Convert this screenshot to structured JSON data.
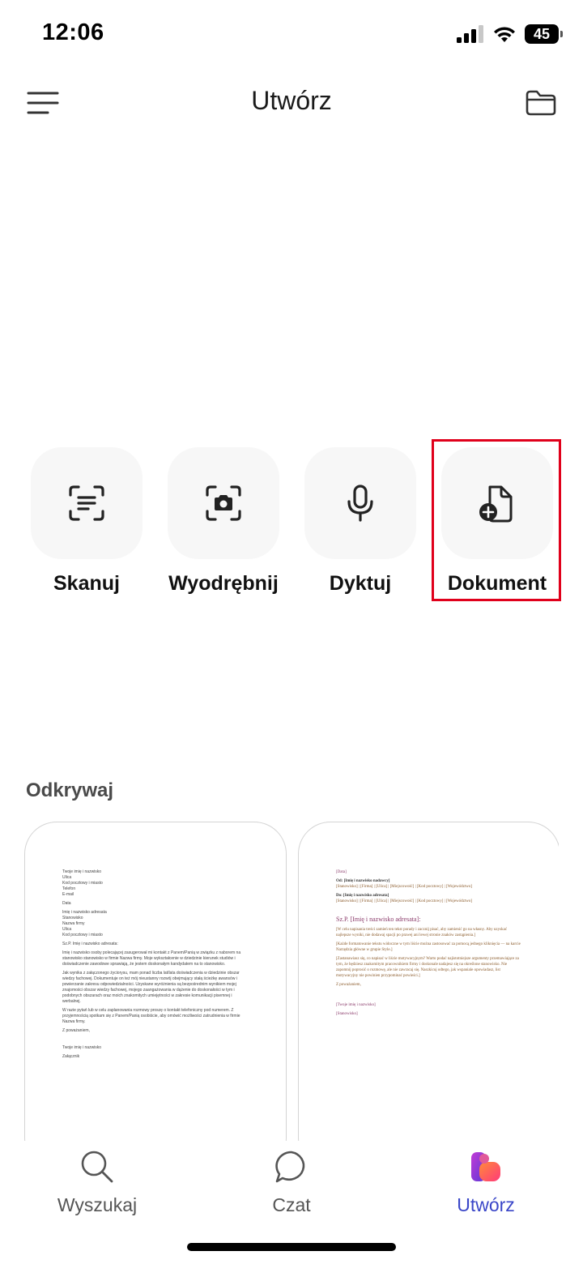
{
  "status_bar": {
    "time": "12:06",
    "battery": "45"
  },
  "header": {
    "title": "Utwórz"
  },
  "actions": [
    {
      "label": "Skanuj",
      "icon": "scan-text-icon"
    },
    {
      "label": "Wyodrębnij",
      "icon": "camera-extract-icon"
    },
    {
      "label": "Dyktuj",
      "icon": "microphone-icon"
    },
    {
      "label": "Dokument",
      "icon": "document-add-icon",
      "highlighted": true
    }
  ],
  "discover": {
    "title": "Odkrywaj",
    "card1": {
      "sender": [
        "Twoje imię i nazwisko",
        "Ulica",
        "Kod pocztowy i miasto",
        "Telefon",
        "E-mail"
      ],
      "date": "Data",
      "recipient": [
        "Imię i nazwisko adresata",
        "Stanowisko",
        "Nazwa firmy",
        "Ulica",
        "Kod pocztowy i miasto"
      ],
      "salutation": "Sz.P. Imię i nazwisko adresata:",
      "para1": "Imię i nazwisko osoby polecającej zasugerował mi kontakt z Panem/Panią w związku z naborem na stanowisko stanowisko w firmie Nazwa firmy. Moje wykształcenie w dziedzinie kierunek studiów i doświadczenie zawodowe sprawiają, że jestem doskonałym kandydatem na to stanowisko.",
      "para2": "Jak wynika z załączonego życiorysu, mam ponad liczba lat/lata doświadczenia w dziedzinie obszar wiedzy fachowej. Dokumentuje on też mój nieustanny rozwój obejmujący stałą ścieżkę awansów i powierzanie zakresu odpowiedzialności. Uzyskane wyróżnienia są bezpośrednim wynikiem mojej znajomości obszar wiedzy fachowej, mojego zaangażowania w dążenie do doskonałości w tym i podobnych obszarach oraz moich znakomitych umiejętności w zakresie komunikacji pisemnej i werbalnej.",
      "para3": "W razie pytań lub w celu zaplanowania rozmowy proszę o kontakt telefoniczny pod numerem. Z przyjemnością spotkam się z Panem/Panią osobiście, aby omówić możliwości zatrudnienia w firmie Nazwa firmy.",
      "closing": "Z poważaniem,",
      "signature": "Twoje imię i nazwisko",
      "attachment": "Załącznik"
    },
    "card2": {
      "date": "[Data]",
      "from_label": "Od: [Imię i nazwisko nadawcy]",
      "from_details": "[Stanowisko] | [Firma] | [Ulica] | [Miejscowość] | [Kod pocztowy] | [Województwo]",
      "to_label": "Do: [Imię i nazwisko adresata]",
      "to_details": "[Stanowisko] | [Firma] | [Ulica] | [Miejscowość] | [Kod pocztowy] | [Województwo]",
      "salutation": "Sz.P. [Imię i nazwisko adresata]:",
      "para1": "[W celu napisania treści zamień ten tekst porady i zacznij pisać, aby zamienić go na własny. Aby uzyskać najlepsze wyniki, nie dodawaj spacji po prawej ani lewej stronie znaków zastąpienia.]",
      "para2": "[Każde formatowanie tekstu widoczne w tym liście można zastosować za pomocą jednego kliknięcia — na karcie Narzędzia główne w grupie Style.]",
      "para3": "[Zastanawiasz się, co napisać w liście motywacyjnym? Warto podać najistotniejsze argumenty przemawiające za tym, że będziesz znakomitym pracownikiem firmy i doskonale nadajesz się na określone stanowisko. Nie zapomnij poprosić o rozmowę, ale nie zawracaj się. Naszkicuj odtego, jak wspaniale opowiadasz, list motywacyjny nie powinien przypominać powieści.]",
      "closing": "Z poważaniem,",
      "signature": "[Twoje imię i nazwisko]",
      "position": "[Stanowisko]"
    }
  },
  "tabbar": [
    {
      "label": "Wyszukaj",
      "icon": "search-icon"
    },
    {
      "label": "Czat",
      "icon": "chat-bubble-icon"
    },
    {
      "label": "Utwórz",
      "icon": "create-app-icon",
      "active": true
    }
  ],
  "colors": {
    "accent": "#3a46c8",
    "highlight": "#e0001b",
    "tile_bg": "#f7f7f7"
  }
}
